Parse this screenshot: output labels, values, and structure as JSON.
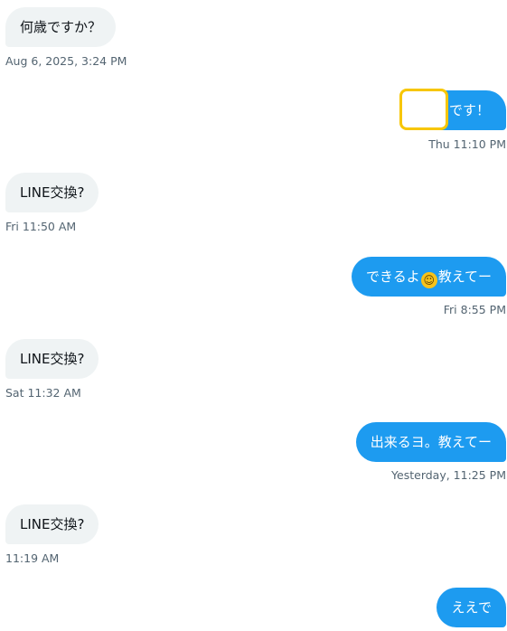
{
  "messages": [
    {
      "direction": "in",
      "text": "何歳ですか？",
      "time": "Aug 6, 2025, 3:24 PM"
    },
    {
      "direction": "out",
      "text": "です！",
      "time": "Thu 11:10 PM"
    },
    {
      "direction": "in",
      "text": "LINE交換?",
      "time": "Fri 11:50 AM"
    },
    {
      "direction": "out",
      "text_before": "できるよ",
      "emoji": "smiley-face",
      "emoji_glyph": "☺",
      "text_after": "教えてー",
      "time": "Fri 8:55 PM"
    },
    {
      "direction": "in",
      "text": "LINE交換?",
      "time": "Sat 11:32 AM"
    },
    {
      "direction": "out",
      "text": "出来るヨ。教えてー",
      "time": "Yesterday, 11:25 PM"
    },
    {
      "direction": "in",
      "text": "LINE交換?",
      "time": "11:19 AM"
    },
    {
      "direction": "out",
      "text": "ええで"
    }
  ],
  "colors": {
    "incoming_bubble": "#eff3f4",
    "outgoing_bubble": "#1d9bf0",
    "highlight_box": "#f7c600",
    "timestamp": "#536471"
  }
}
